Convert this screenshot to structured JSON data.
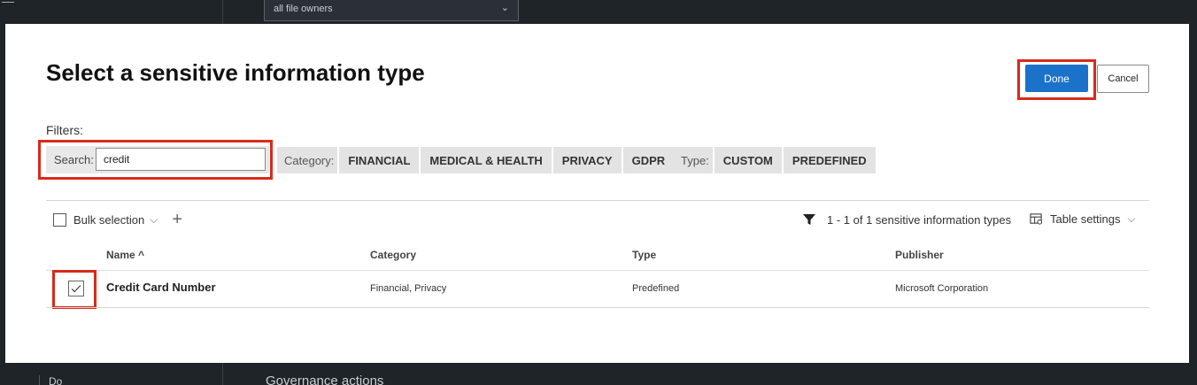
{
  "background": {
    "owner_dropdown": "all file owners",
    "section_title": "Governance actions",
    "left_text": "Do"
  },
  "modal": {
    "title": "Select a sensitive information type",
    "done_label": "Done",
    "cancel_label": "Cancel",
    "filters_label": "Filters:",
    "search": {
      "label": "Search:",
      "value": "credit"
    },
    "category": {
      "label": "Category:",
      "options": [
        "FINANCIAL",
        "MEDICAL & HEALTH",
        "PRIVACY",
        "GDPR"
      ]
    },
    "type": {
      "label": "Type:",
      "options": [
        "CUSTOM",
        "PREDEFINED"
      ]
    },
    "toolbar": {
      "bulk_label": "Bulk selection",
      "count_text": "1 - 1 of 1 sensitive information types",
      "table_settings": "Table settings"
    },
    "table": {
      "headers": [
        "Name",
        "Category",
        "Type",
        "Publisher"
      ],
      "rows": [
        {
          "name": "Credit Card Number",
          "category": "Financial, Privacy",
          "type": "Predefined",
          "publisher": "Microsoft Corporation",
          "checked": true
        }
      ]
    }
  },
  "colors": {
    "accent": "#1a73c9",
    "highlight": "#d92a1a"
  }
}
